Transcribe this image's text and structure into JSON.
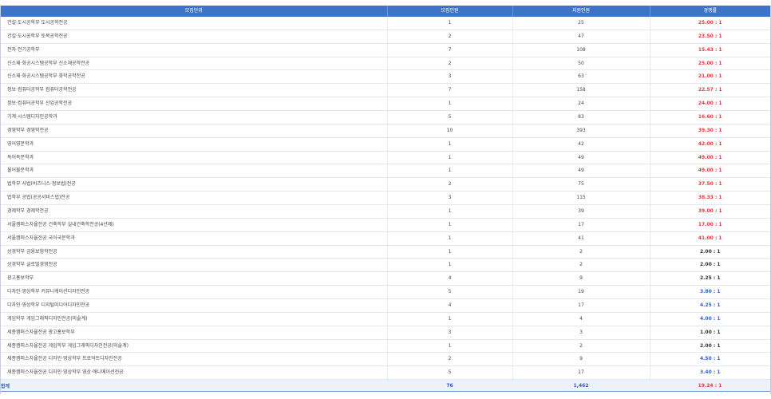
{
  "table": {
    "headers": [
      "모집단위",
      "모집인원",
      "지원인원",
      "경쟁률"
    ],
    "rows": [
      {
        "unit": "건설·도시공학부 도시공학전공",
        "quota": "1",
        "applicants": "25",
        "ratio": "25.00 : 1",
        "tone": "red"
      },
      {
        "unit": "건설·도시공학부 토목공학전공",
        "quota": "2",
        "applicants": "47",
        "ratio": "23.50 : 1",
        "tone": "red"
      },
      {
        "unit": "전자·전기공학부",
        "quota": "7",
        "applicants": "108",
        "ratio": "15.43 : 1",
        "tone": "red"
      },
      {
        "unit": "신소재·화공시스템공학부 신소재공학전공",
        "quota": "2",
        "applicants": "50",
        "ratio": "25.00 : 1",
        "tone": "red"
      },
      {
        "unit": "신소재·화공시스템공학부 화학공학전공",
        "quota": "3",
        "applicants": "63",
        "ratio": "21.00 : 1",
        "tone": "red"
      },
      {
        "unit": "정보·컴퓨터공학부 컴퓨터공학전공",
        "quota": "7",
        "applicants": "158",
        "ratio": "22.57 : 1",
        "tone": "red"
      },
      {
        "unit": "정보·컴퓨터공학부 산업공학전공",
        "quota": "1",
        "applicants": "24",
        "ratio": "24.00 : 1",
        "tone": "red"
      },
      {
        "unit": "기계·시스템디자인공학과",
        "quota": "5",
        "applicants": "83",
        "ratio": "16.60 : 1",
        "tone": "red"
      },
      {
        "unit": "경영학부 경영학전공",
        "quota": "10",
        "applicants": "393",
        "ratio": "39.30 : 1",
        "tone": "red"
      },
      {
        "unit": "영어영문학과",
        "quota": "1",
        "applicants": "42",
        "ratio": "42.00 : 1",
        "tone": "red"
      },
      {
        "unit": "독어독문학과",
        "quota": "1",
        "applicants": "49",
        "ratio": "49.00 : 1",
        "tone": "red"
      },
      {
        "unit": "불어불문학과",
        "quota": "1",
        "applicants": "49",
        "ratio": "49.00 : 1",
        "tone": "red"
      },
      {
        "unit": "법학부 사법(비즈니스·정보법)전공",
        "quota": "2",
        "applicants": "75",
        "ratio": "37.50 : 1",
        "tone": "red"
      },
      {
        "unit": "법학부 공법(공공서비스법)전공",
        "quota": "3",
        "applicants": "115",
        "ratio": "38.33 : 1",
        "tone": "red"
      },
      {
        "unit": "경제학부 경제학전공",
        "quota": "1",
        "applicants": "39",
        "ratio": "39.00 : 1",
        "tone": "red"
      },
      {
        "unit": "서울캠퍼스자율전공 건축학부 실내건축학전공(4년제)",
        "quota": "1",
        "applicants": "17",
        "ratio": "17.00 : 1",
        "tone": "red"
      },
      {
        "unit": "서울캠퍼스자율전공 국어국문학과",
        "quota": "1",
        "applicants": "41",
        "ratio": "41.00 : 1",
        "tone": "red"
      },
      {
        "unit": "상경학부 금융보험학전공",
        "quota": "1",
        "applicants": "2",
        "ratio": "2.00 : 1",
        "tone": "black"
      },
      {
        "unit": "상경학부 글로벌경영전공",
        "quota": "1",
        "applicants": "2",
        "ratio": "2.00 : 1",
        "tone": "black"
      },
      {
        "unit": "광고홍보학부",
        "quota": "4",
        "applicants": "9",
        "ratio": "2.25 : 1",
        "tone": "black"
      },
      {
        "unit": "디자인·영상학부 커뮤니케이션디자인전공",
        "quota": "5",
        "applicants": "19",
        "ratio": "3.80 : 1",
        "tone": "blue"
      },
      {
        "unit": "디자인·영상학부 디지털미디어디자인전공",
        "quota": "4",
        "applicants": "17",
        "ratio": "4.25 : 1",
        "tone": "blue"
      },
      {
        "unit": "게임학부 게임그래픽디자인전공(미술계)",
        "quota": "1",
        "applicants": "4",
        "ratio": "4.00 : 1",
        "tone": "blue"
      },
      {
        "unit": "세종캠퍼스자율전공 광고홍보학부",
        "quota": "3",
        "applicants": "3",
        "ratio": "1.00 : 1",
        "tone": "black"
      },
      {
        "unit": "세종캠퍼스자율전공 게임학부 게임그래픽디자인전공(미술계)",
        "quota": "1",
        "applicants": "2",
        "ratio": "2.00 : 1",
        "tone": "black"
      },
      {
        "unit": "세종캠퍼스자율전공 디자인·영상학부 프로덕트디자인전공",
        "quota": "2",
        "applicants": "9",
        "ratio": "4.50 : 1",
        "tone": "blue"
      },
      {
        "unit": "세종캠퍼스자율전공 디자인·영상학부 영상·애니메이션전공",
        "quota": "5",
        "applicants": "17",
        "ratio": "3.40 : 1",
        "tone": "blue"
      }
    ],
    "total": {
      "label": "합계",
      "quota": "76",
      "applicants": "1,462",
      "ratio": "19.24 : 1"
    }
  },
  "colors": {
    "header_bg": "#3f73c8",
    "ratio_high": "#e33b3b",
    "ratio_mid": "#2f64c8",
    "ratio_low": "#333333",
    "total_bg": "#edf2fa"
  }
}
